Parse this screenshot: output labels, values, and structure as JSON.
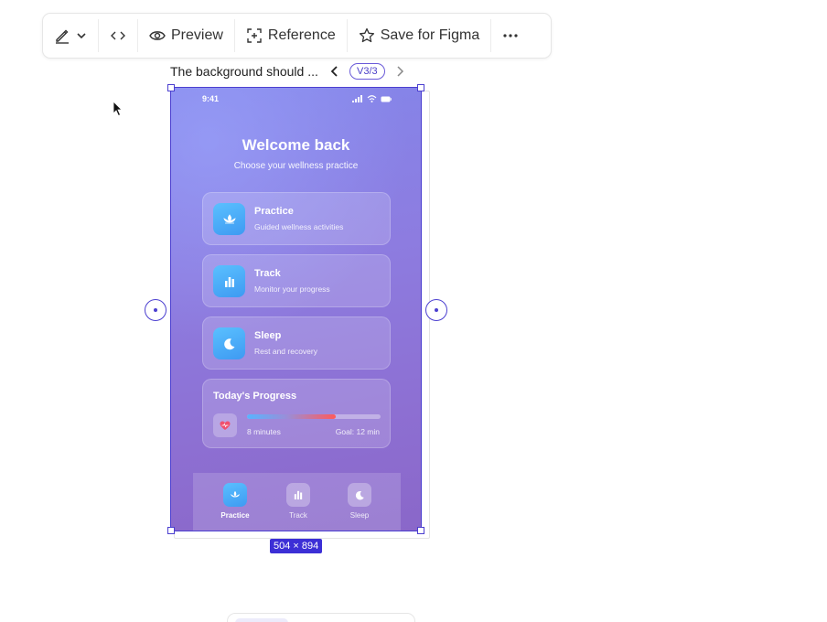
{
  "toolbar": {
    "edit_icon": "pencil-icon",
    "dropdown_icon": "chevron-down-icon",
    "code_icon": "code-icon",
    "preview_label": "Preview",
    "preview_icon": "eye-icon",
    "reference_label": "Reference",
    "reference_icon": "frame-select-icon",
    "save_label": "Save for Figma",
    "save_icon": "star-icon",
    "more_icon": "more-icon"
  },
  "version": {
    "title": "The background should ...",
    "badge": "V3/3"
  },
  "canvas": {
    "size_label": "504 × 894",
    "selection_color": "#4b3fd0"
  },
  "app": {
    "time": "9:41",
    "heading": "Welcome back",
    "subheading": "Choose your wellness practice",
    "cards": [
      {
        "title": "Practice",
        "subtitle": "Guided wellness activities",
        "icon": "lotus-icon"
      },
      {
        "title": "Track",
        "subtitle": "Monitor your progress",
        "icon": "bar-chart-icon"
      },
      {
        "title": "Sleep",
        "subtitle": "Rest and recovery",
        "icon": "moon-icon"
      }
    ],
    "progress": {
      "title": "Today's Progress",
      "left_label": "8 minutes",
      "right_label": "Goal: 12 min",
      "fraction": 0.667,
      "icon": "heart-icon"
    },
    "tabs": [
      {
        "label": "Practice",
        "icon": "lotus-icon",
        "active": true
      },
      {
        "label": "Track",
        "icon": "bar-chart-icon",
        "active": false
      },
      {
        "label": "Sleep",
        "icon": "moon-icon",
        "active": false
      }
    ]
  }
}
